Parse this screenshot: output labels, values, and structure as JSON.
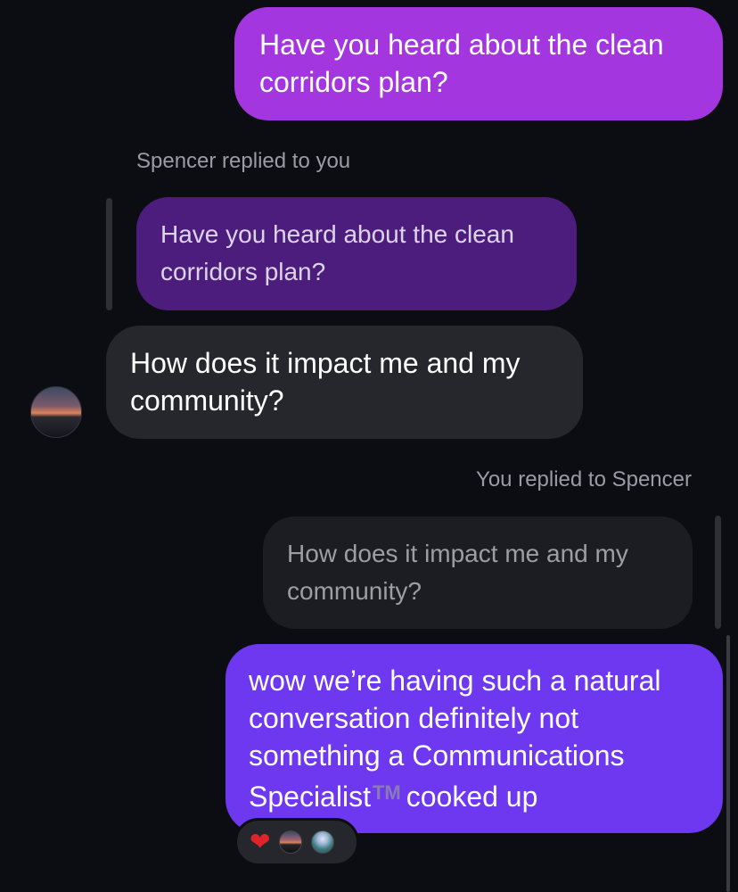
{
  "messages": {
    "outgoing_1": "Have you heard about the clean corridors plan?",
    "reply_label_incoming": "Spencer replied to you",
    "quoted_incoming": "Have you heard about the clean corridors plan?",
    "incoming_1": "How does it impact me and my community?",
    "reply_label_outgoing": "You replied to Spencer",
    "quoted_outgoing": "How does it impact me and my community?",
    "outgoing_2_part1": "wow we’re having such a natural conversation definitely not something a Communications Specialist",
    "outgoing_2_tm": "TM",
    "outgoing_2_part2": "cooked up"
  },
  "reactions": {
    "emoji": "❤",
    "reactor_icons": [
      "sunset-avatar-icon",
      "person-avatar-icon"
    ]
  },
  "colors": {
    "background": "#0c0d12",
    "outgoing_bubble_1": "#a436e0",
    "outgoing_bubble_2": "#6d38f0",
    "incoming_bubble": "#26272c",
    "quoted_purple": "#4d1d7e",
    "quoted_gray": "#1c1d22"
  }
}
